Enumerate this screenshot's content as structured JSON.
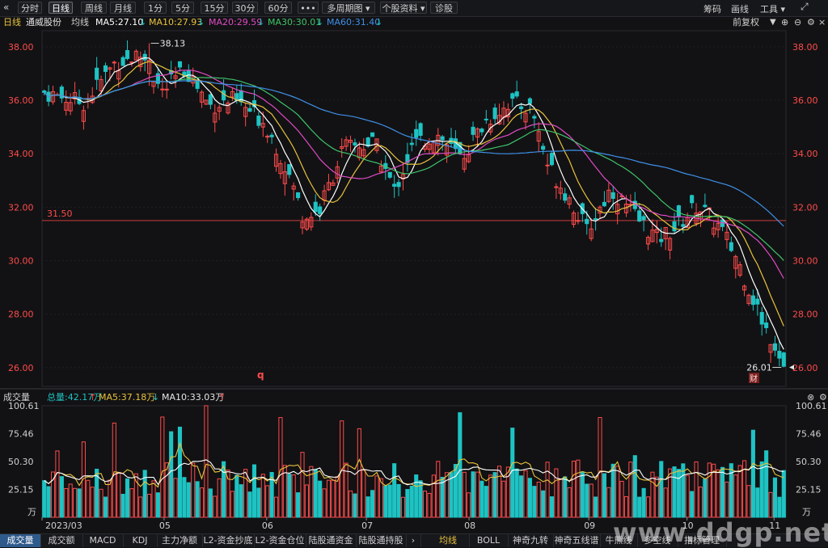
{
  "toolbar": {
    "collapse_icon": "double-chevron-left-icon",
    "buttons": [
      {
        "label": "分时",
        "active": false
      },
      {
        "label": "日线",
        "active": true
      },
      {
        "label": "周线",
        "active": false
      },
      {
        "label": "月线",
        "active": false
      },
      {
        "label": "1分",
        "active": false
      },
      {
        "label": "5分",
        "active": false
      },
      {
        "label": "15分",
        "active": false
      },
      {
        "label": "30分",
        "active": false
      },
      {
        "label": "60分",
        "active": false
      },
      {
        "label": "•••",
        "active": false
      },
      {
        "label": "多周期图",
        "active": false
      },
      {
        "label": "个股资料",
        "active": false
      },
      {
        "label": "诊股",
        "active": false
      }
    ],
    "right": {
      "chips": "筹码",
      "draw": "画线",
      "tools": "工具"
    }
  },
  "info": {
    "period": "日线",
    "stock": "通威股份",
    "ma_label": "均线",
    "ma5": "MA5:27.10",
    "ma10": "MA10:27.93",
    "ma20": "MA20:29.59",
    "ma30": "MA30:30.01",
    "ma60": "MA60:31.40",
    "adjust": "前复权"
  },
  "volume_info": {
    "title": "成交量",
    "total": "总量:42.17万",
    "ma5": "MA5:37.18万",
    "ma10": "MA10:33.03万"
  },
  "colors": {
    "up": "#ff4b4b",
    "down": "#1fc3c3",
    "ma5": "#ffffff",
    "ma10": "#e8c23c",
    "ma20": "#e04bc4",
    "ma30": "#3fc46a",
    "ma60": "#3f8fe8"
  },
  "annotations": {
    "high": "38.13",
    "low": "26.01",
    "ref_line": "31.50",
    "q_marker": "q",
    "fin_marker": "财"
  },
  "chart_data": [
    {
      "type": "candlestick",
      "title": "通威股份 日线",
      "y_ticks": [
        "38.00",
        "36.00",
        "34.00",
        "32.00",
        "30.00",
        "28.00",
        "26.00"
      ],
      "ylim": [
        25.3,
        38.6
      ],
      "x_ticks": [
        "2023/03",
        "05",
        "06",
        "07",
        "08",
        "09",
        "10",
        "11"
      ],
      "n_bars": 170,
      "highest": 38.13,
      "lowest": 26.01,
      "reference_line": 31.5,
      "series": [
        {
          "name": "MA5",
          "last": 27.1
        },
        {
          "name": "MA10",
          "last": 27.93
        },
        {
          "name": "MA20",
          "last": 29.59
        },
        {
          "name": "MA30",
          "last": 30.01
        },
        {
          "name": "MA60",
          "last": 31.4
        }
      ],
      "anchors": [
        [
          0,
          36.3
        ],
        [
          10,
          35.9
        ],
        [
          18,
          37.4
        ],
        [
          25,
          37.7
        ],
        [
          30,
          36.3
        ],
        [
          36,
          37.2
        ],
        [
          42,
          35.8
        ],
        [
          48,
          36.0
        ],
        [
          56,
          35.2
        ],
        [
          62,
          33.3
        ],
        [
          66,
          31.6
        ],
        [
          70,
          31.9
        ],
        [
          76,
          34.2
        ],
        [
          84,
          34.4
        ],
        [
          89,
          32.6
        ],
        [
          94,
          34.4
        ],
        [
          100,
          34.7
        ],
        [
          106,
          33.8
        ],
        [
          112,
          35.2
        ],
        [
          118,
          35.9
        ],
        [
          124,
          35.7
        ],
        [
          128,
          33.6
        ],
        [
          134,
          32.2
        ],
        [
          138,
          31.1
        ],
        [
          144,
          32.7
        ],
        [
          150,
          31.7
        ],
        [
          156,
          30.8
        ],
        [
          161,
          31.3
        ],
        [
          166,
          32.1
        ],
        [
          172,
          31.2
        ],
        [
          176,
          30.1
        ],
        [
          181,
          28.3
        ],
        [
          184,
          27.3
        ],
        [
          188,
          26.3
        ]
      ]
    },
    {
      "type": "bar",
      "title": "成交量",
      "y_ticks": [
        "100.61",
        "75.46",
        "50.30",
        "25.15",
        "万"
      ],
      "ylim": [
        0,
        100.61
      ],
      "unit": "万",
      "series": [
        {
          "name": "总量",
          "last": 42.17
        },
        {
          "name": "MA5",
          "last": 37.18
        },
        {
          "name": "MA10",
          "last": 33.03
        }
      ]
    }
  ],
  "bottom_tabs": [
    "成交量",
    "成交额",
    "MACD",
    "KDJ",
    "主力净额",
    "L2-资金抄底",
    "L2-资金仓位",
    "陆股通资金",
    "陆股通持股",
    "均线",
    "BOLL",
    "神奇九转",
    "神奇五线谱",
    "牛熊线",
    "多空线",
    "指标管理"
  ],
  "watermark": "www.ddgp.net"
}
